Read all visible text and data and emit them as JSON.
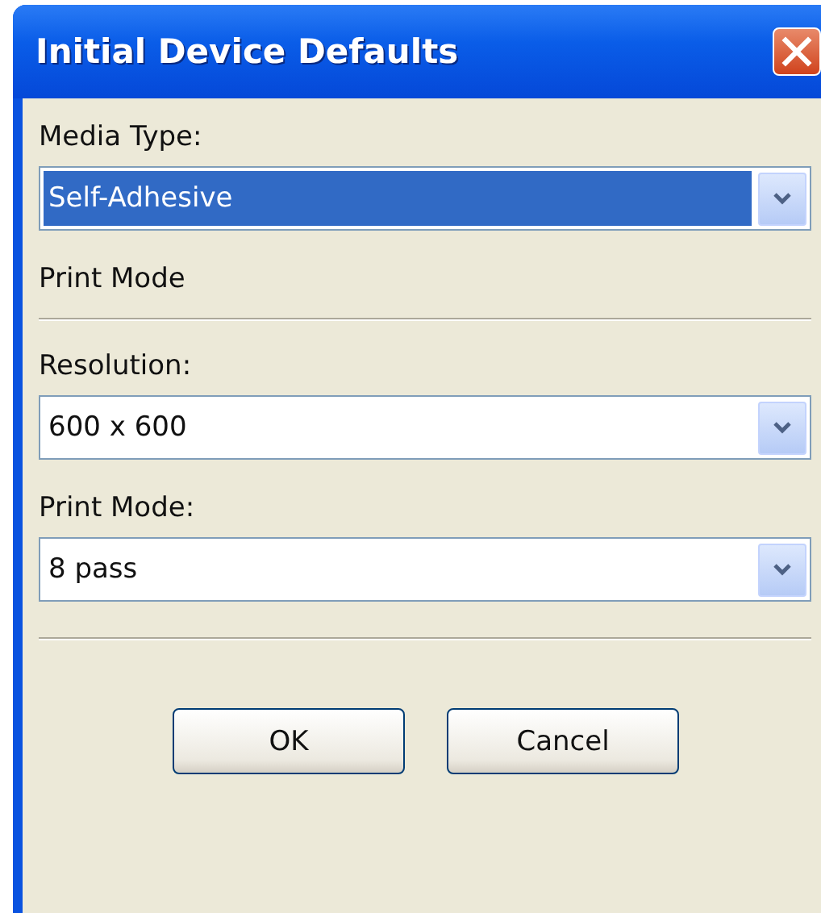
{
  "window": {
    "title": "Initial Device Defaults"
  },
  "sections": [
    {
      "kind": "field",
      "label": "Media Type:",
      "value": "Self-Adhesive",
      "highlighted": true
    },
    {
      "kind": "heading",
      "label": "Print Mode"
    },
    {
      "kind": "divider"
    },
    {
      "kind": "field",
      "label": "Resolution:",
      "value": "600 x 600",
      "highlighted": false
    },
    {
      "kind": "field",
      "label": "Print Mode:",
      "value": "8 pass",
      "highlighted": false
    },
    {
      "kind": "divider"
    }
  ],
  "buttons": [
    "OK",
    "Cancel"
  ]
}
